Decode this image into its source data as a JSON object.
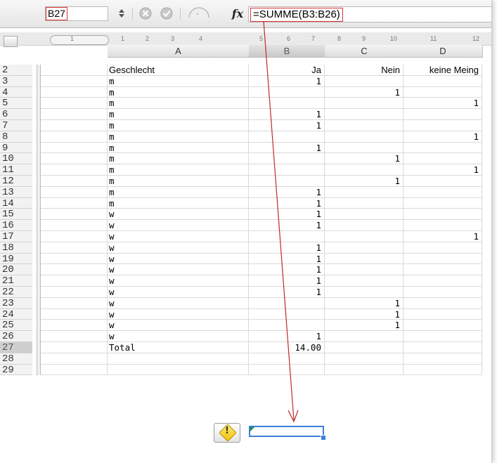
{
  "formula_bar": {
    "cell_ref": "B27",
    "formula": "=SUMME(B3:B26)",
    "fx_label": "fx"
  },
  "columns": [
    {
      "id": "A",
      "label": "A"
    },
    {
      "id": "B",
      "label": "B"
    },
    {
      "id": "C",
      "label": "C"
    },
    {
      "id": "D",
      "label": "D"
    }
  ],
  "ruler": {
    "labels": [
      "1",
      "1",
      "2",
      "3",
      "4",
      "5",
      "6",
      "7",
      "8",
      "9",
      "10",
      "11",
      "12"
    ]
  },
  "rows": [
    {
      "n": "2",
      "a": "Geschlecht",
      "b": "Ja",
      "c": "Nein",
      "d": "keine Meing"
    },
    {
      "n": "3",
      "a": "m",
      "b": "1",
      "c": "",
      "d": ""
    },
    {
      "n": "4",
      "a": "m",
      "b": "",
      "c": "1",
      "d": ""
    },
    {
      "n": "5",
      "a": "m",
      "b": "",
      "c": "",
      "d": "1"
    },
    {
      "n": "6",
      "a": "m",
      "b": "1",
      "c": "",
      "d": ""
    },
    {
      "n": "7",
      "a": "m",
      "b": "1",
      "c": "",
      "d": ""
    },
    {
      "n": "8",
      "a": "m",
      "b": "",
      "c": "",
      "d": "1"
    },
    {
      "n": "9",
      "a": "m",
      "b": "1",
      "c": "",
      "d": ""
    },
    {
      "n": "10",
      "a": "m",
      "b": "",
      "c": "1",
      "d": ""
    },
    {
      "n": "11",
      "a": "m",
      "b": "",
      "c": "",
      "d": "1"
    },
    {
      "n": "12",
      "a": "m",
      "b": "",
      "c": "1",
      "d": ""
    },
    {
      "n": "13",
      "a": "m",
      "b": "1",
      "c": "",
      "d": ""
    },
    {
      "n": "14",
      "a": "m",
      "b": "1",
      "c": "",
      "d": ""
    },
    {
      "n": "15",
      "a": "w",
      "b": "1",
      "c": "",
      "d": ""
    },
    {
      "n": "16",
      "a": "w",
      "b": "1",
      "c": "",
      "d": ""
    },
    {
      "n": "17",
      "a": "w",
      "b": "",
      "c": "",
      "d": "1"
    },
    {
      "n": "18",
      "a": "w",
      "b": "1",
      "c": "",
      "d": ""
    },
    {
      "n": "19",
      "a": "w",
      "b": "1",
      "c": "",
      "d": ""
    },
    {
      "n": "20",
      "a": "w",
      "b": "1",
      "c": "",
      "d": ""
    },
    {
      "n": "21",
      "a": "w",
      "b": "1",
      "c": "",
      "d": ""
    },
    {
      "n": "22",
      "a": "w",
      "b": "1",
      "c": "",
      "d": ""
    },
    {
      "n": "23",
      "a": "w",
      "b": "",
      "c": "1",
      "d": ""
    },
    {
      "n": "24",
      "a": "w",
      "b": "",
      "c": "1",
      "d": ""
    },
    {
      "n": "25",
      "a": "w",
      "b": "",
      "c": "1",
      "d": ""
    },
    {
      "n": "26",
      "a": "w",
      "b": "1",
      "c": "",
      "d": ""
    },
    {
      "n": "27",
      "a": "Total",
      "b": "14.00",
      "c": "",
      "d": ""
    },
    {
      "n": "28",
      "a": "",
      "b": "",
      "c": "",
      "d": ""
    },
    {
      "n": "29",
      "a": "",
      "b": "",
      "c": "",
      "d": ""
    }
  ],
  "icons": {
    "stepper": "stepper-icon",
    "cancel": "cancel-icon",
    "confirm": "confirm-icon",
    "function": "function-icon",
    "warning": "warning-icon"
  },
  "colors": {
    "highlight_red": "#dd3333",
    "selection_blue": "#3d7fd6",
    "annotation_arrow": "#c0282d"
  }
}
